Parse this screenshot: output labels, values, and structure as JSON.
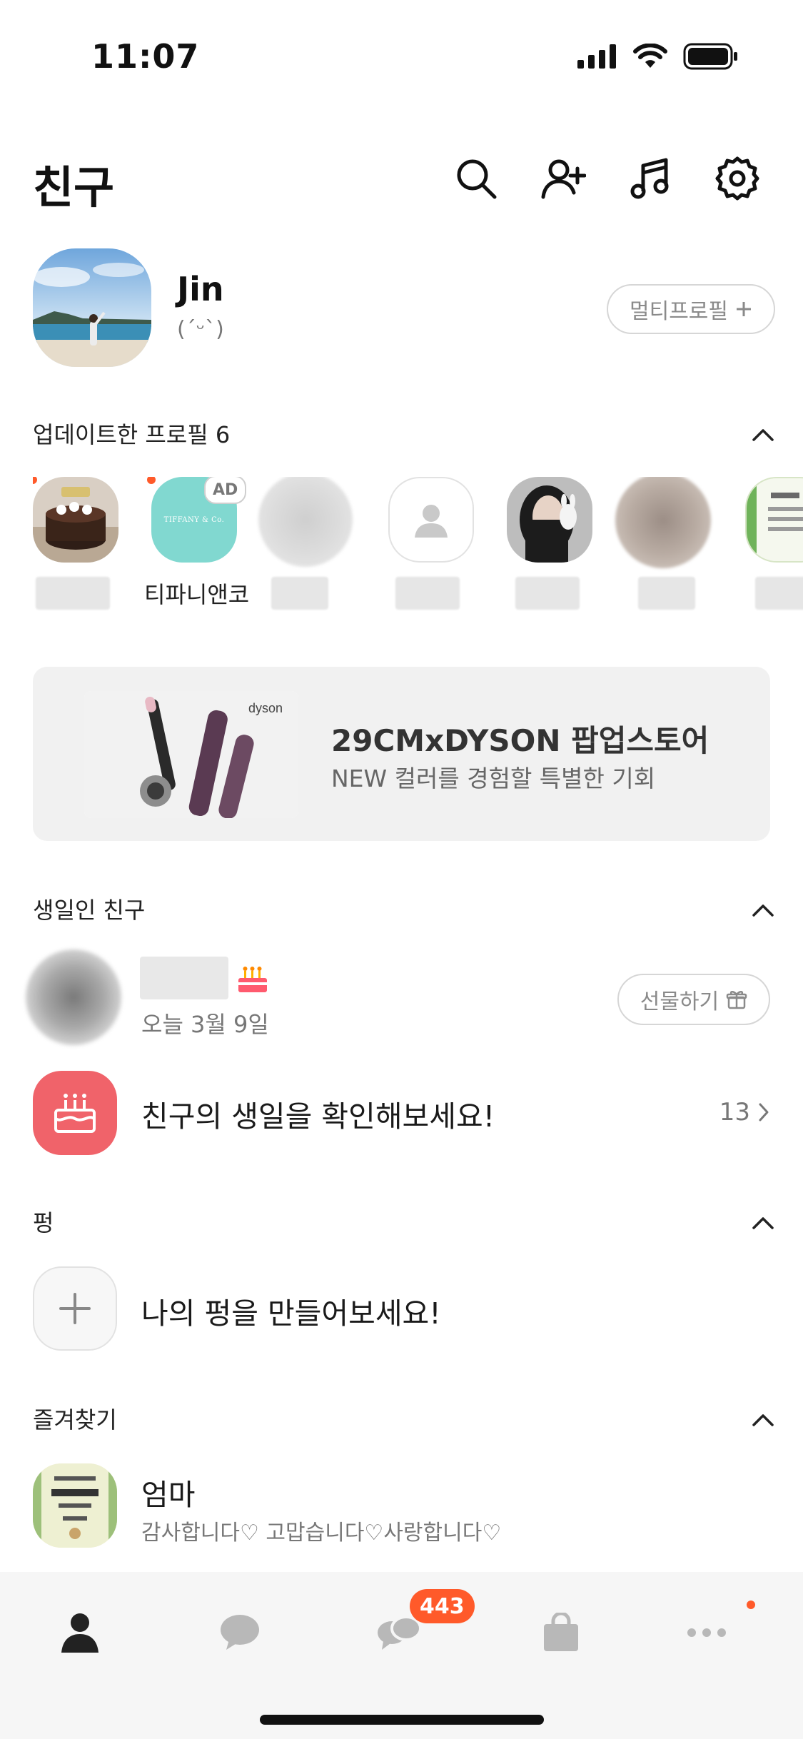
{
  "status_bar": {
    "time": "11:07"
  },
  "header": {
    "title": "친구",
    "icons": [
      "search-icon",
      "add-friend-icon",
      "music-icon",
      "settings-icon"
    ]
  },
  "profile": {
    "name": "Jin",
    "status": "(´ᵕ`)",
    "multi_profile_label": "멀티프로필"
  },
  "updated_profiles": {
    "title": "업데이트한 프로필 6",
    "items": [
      {
        "has_new": true
      },
      {
        "has_new": true,
        "name": "티파니앤코",
        "ad_label": "AD",
        "logo_text": "TIFFANY & Co."
      },
      {
        "has_new": false
      },
      {
        "has_new": false
      },
      {
        "has_new": false
      },
      {
        "has_new": false
      },
      {
        "has_new": false
      }
    ]
  },
  "banner": {
    "title": "29CMxDYSON 팝업스토어",
    "subtitle": "NEW 컬러를 경험할 특별한 기회",
    "brand_text": "dyson"
  },
  "birthday": {
    "title": "생일인 친구",
    "friend_date": "오늘 3월 9일",
    "gift_label": "선물하기",
    "check_label": "친구의 생일을 확인해보세요!",
    "check_count": "13"
  },
  "pung": {
    "title": "펑",
    "create_label": "나의 펑을 만들어보세요!"
  },
  "favorites": {
    "title": "즐겨찾기",
    "items": [
      {
        "name": "엄마",
        "status": "감사합니다♡ 고맙습니다♡사랑합니다♡"
      }
    ]
  },
  "tabbar": {
    "chat_badge": "443",
    "tabs": [
      "friends-tab",
      "chats-tab",
      "openchat-tab",
      "shopping-tab",
      "more-tab"
    ]
  },
  "colors": {
    "accent_badge": "#ff5a2a",
    "birthday_icon_bg": "#f0636a",
    "tiffany": "#81d8d0"
  }
}
